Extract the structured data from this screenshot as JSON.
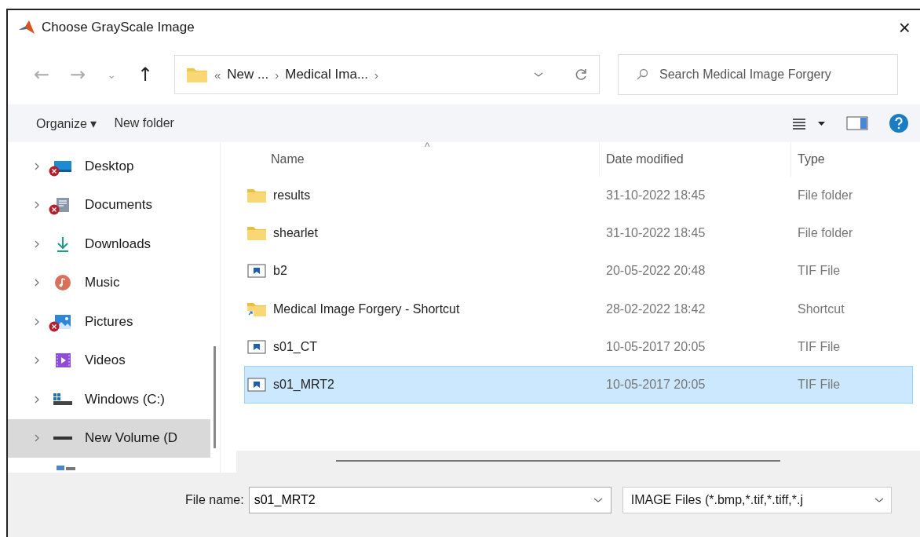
{
  "window": {
    "title": "Choose GrayScale Image",
    "close": "×"
  },
  "nav": {
    "back": "←",
    "forward": "→",
    "recent": "⌄",
    "up": "↑"
  },
  "breadcrumb": {
    "overflow": "«",
    "parts": [
      "New ...",
      "Medical Ima..."
    ],
    "separator": "›"
  },
  "search": {
    "placeholder": "Search Medical Image Forgery"
  },
  "commands": {
    "organize": "Organize ▾",
    "new_folder": "New folder"
  },
  "sidebar": {
    "items": [
      {
        "label": "Desktop",
        "kind": "desktop",
        "error": true,
        "selected": false
      },
      {
        "label": "Documents",
        "kind": "documents",
        "error": true,
        "selected": false
      },
      {
        "label": "Downloads",
        "kind": "downloads",
        "error": false,
        "selected": false
      },
      {
        "label": "Music",
        "kind": "music",
        "error": false,
        "selected": false
      },
      {
        "label": "Pictures",
        "kind": "pictures",
        "error": true,
        "selected": false
      },
      {
        "label": "Videos",
        "kind": "videos",
        "error": false,
        "selected": false
      },
      {
        "label": "Windows (C:)",
        "kind": "drive",
        "error": false,
        "selected": false
      },
      {
        "label": "New Volume (D",
        "kind": "volume",
        "error": false,
        "selected": true
      }
    ]
  },
  "table": {
    "columns": [
      "Name",
      "Date modified",
      "Type"
    ],
    "sort_mark": "^",
    "rows": [
      {
        "name": "results",
        "kind": "folder",
        "date": "31-10-2022 18:45",
        "type": "File folder",
        "selected": false
      },
      {
        "name": "shearlet",
        "kind": "folder",
        "date": "31-10-2022 18:45",
        "type": "File folder",
        "selected": false
      },
      {
        "name": "b2",
        "kind": "image",
        "date": "20-05-2022 20:48",
        "type": "TIF File",
        "selected": false
      },
      {
        "name": "Medical Image Forgery - Shortcut",
        "kind": "shortcut",
        "date": "28-02-2022 18:42",
        "type": "Shortcut",
        "selected": false
      },
      {
        "name": "s01_CT",
        "kind": "image",
        "date": "10-05-2017 20:05",
        "type": "TIF File",
        "selected": false
      },
      {
        "name": "s01_MRT2",
        "kind": "image",
        "date": "10-05-2017 20:05",
        "type": "TIF File",
        "selected": true
      }
    ]
  },
  "footer": {
    "file_name_label": "File name:",
    "file_name": "s01_MRT2",
    "filter": "IMAGE Files (*.bmp,*.tif,*.tiff,*.j"
  }
}
